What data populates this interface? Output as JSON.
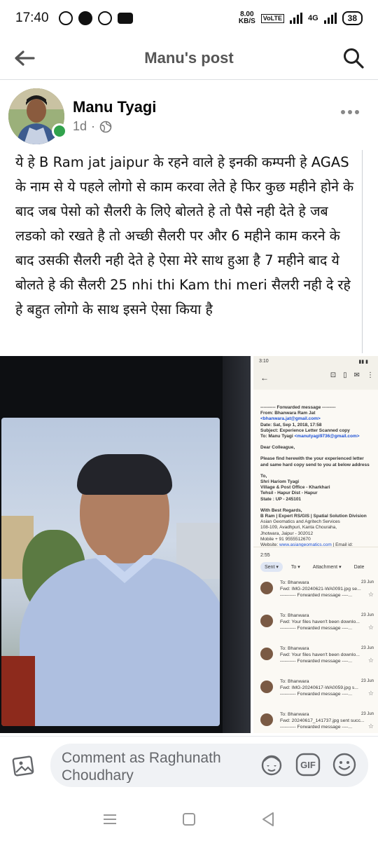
{
  "status_bar": {
    "time": "17:40",
    "net_speed_top": "8.00",
    "net_speed_unit": "KB/S",
    "volte": "VoLTE",
    "network": "4G",
    "battery": "38"
  },
  "app_bar": {
    "title": "Manu's post",
    "back_icon": "arrow-left-icon",
    "search_icon": "search-icon"
  },
  "post": {
    "author": "Manu Tyagi",
    "time_ago": "1d",
    "audience_icon": "globe-icon",
    "more_icon": "more-horizontal-icon",
    "text": "ये हे B Ram jat jaipur के रहने वाले हे इनकी कम्पनी हे AGAS के नाम से ये पहले लोगो से काम करवा लेते हे  फिर कुछ महीने होने के बाद जब पेसो को सैलरी के लिऐ बोलते हे तो पैसे नही देते हे जब लडको को रखते है तो अच्छी सैलरी पर और 6 महीने काम करने के बाद उसकी सैलरी नही देते हे ऐसा मेरे साथ हुआ है 7 महीने बाद ये बोलते हे की सैलरी 25 nhi thi Kam thi meri सैलरी नही दे रहे हे बहुत लोगो के साथ इसने ऐसा किया है"
  },
  "screenshot": {
    "time1": "3:10",
    "header": "---------- Forwarded message ---------",
    "from_label": "From:",
    "from_name": "Bhanwara Ram Jat",
    "from_email": "<bhanwara.jat@gmail.com>",
    "date": "Date: Sat, Sep 1, 2018, 17:58",
    "subject": "Subject: Experience Letter Scanned copy",
    "to_label": "To: Manu Tyagi",
    "to_email": "<manutyagi9736@gmail.com>",
    "greeting": "Dear Colleague,",
    "body": "Please find herewith the your experienced letter and same hard copy send to you at below address",
    "addr1": "To,",
    "addr2": "Shri Hariom Tyagi",
    "addr3": "Village & Post Office - Kharkhari",
    "addr4": "Tehsil - Hapur Dist - Hapur",
    "addr5": "State : UP - 245101",
    "sig1": "With Best Regards,",
    "sig2": "B Ram | Expert RS/GIS | Spatial Solution Division",
    "sig3": "Asian Geomatics and Agritech Services",
    "sig4": "108-109, Avadhpuri, Kanta Chouraha,",
    "sig5": "Jhotwara, Jaipur - 302012",
    "sig6": "Mobile + 91 9555512670",
    "sig7_label": "Website:",
    "sig7_link": "www.asiangeomatics.com",
    "sig7_end": "| Email id:",
    "time2": "2:55",
    "filters": [
      "Sent ▾",
      "To ▾",
      "Attachment ▾",
      "Date"
    ],
    "mails": [
      {
        "to": "To: Bhanwara",
        "date": "23 Jun",
        "subject": "Fwd: IMG-20240621-WA0091.jpg se...",
        "preview": "---------- Forwarded message ----..."
      },
      {
        "to": "To: Bhanwara",
        "date": "23 Jun",
        "subject": "Fwd: Your files haven't been downlo...",
        "preview": "---------- Forwarded message ----..."
      },
      {
        "to": "To: Bhanwara",
        "date": "23 Jun",
        "subject": "Fwd: Your files haven't been downlo...",
        "preview": "---------- Forwarded message ----..."
      },
      {
        "to": "To: Bhanwara",
        "date": "23 Jun",
        "subject": "Fwd: IMG-20240617-WA0059.jpg s...",
        "preview": "---------- Forwarded message ----..."
      },
      {
        "to": "To: Bhanwara",
        "date": "23 Jun",
        "subject": "Fwd: 20240617_141737.jpg sent succ...",
        "preview": "---------- Forwarded message ----..."
      }
    ]
  },
  "comment_bar": {
    "placeholder": "Comment as Raghunath Choudhary",
    "gif_label": "GIF",
    "icons": [
      "photo-icon",
      "avatar-sticker-icon",
      "gif-icon",
      "emoji-icon"
    ]
  },
  "nav_bar": {
    "icons": [
      "recents-icon",
      "home-icon",
      "back-icon"
    ]
  }
}
